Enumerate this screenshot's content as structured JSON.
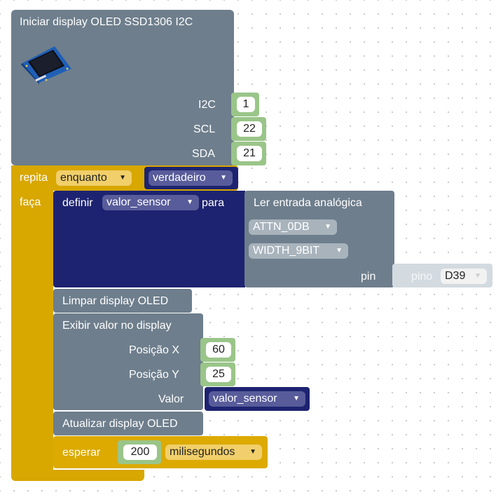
{
  "init_block": {
    "title": "Iniciar display OLED SSD1306 I2C",
    "i2c_label": "I2C",
    "i2c_value": "1",
    "scl_label": "SCL",
    "scl_value": "22",
    "sda_label": "SDA",
    "sda_value": "21"
  },
  "loop_block": {
    "repeat_label": "repita",
    "mode_option": "enquanto",
    "condition_value": "verdadeiro",
    "do_label": "faça"
  },
  "set_block": {
    "label": "definir",
    "variable": "valor_sensor",
    "to_label": "para"
  },
  "analog_block": {
    "title": "Ler entrada analógica",
    "attenuation": "ATTN_0DB",
    "width": "WIDTH_9BIT",
    "pin_label": "pin",
    "pin_block_label": "pino",
    "pin_value": "D39"
  },
  "clear_block": {
    "label": "Limpar display OLED"
  },
  "show_block": {
    "title": "Exibir valor no display",
    "posx_label": "Posição X",
    "posx_value": "60",
    "posy_label": "Posição Y",
    "posy_value": "25",
    "value_label": "Valor",
    "value_variable": "valor_sensor"
  },
  "update_block": {
    "label": "Atualizar display OLED"
  },
  "wait_block": {
    "label": "esperar",
    "amount": "200",
    "unit": "milisegundos"
  },
  "colors": {
    "gray_block": "#6e7e8c",
    "gold_block": "#d8a700",
    "navy_block": "#1d2370",
    "green_block": "#9ac589"
  },
  "icons": {
    "dropdown": "caret-down-icon",
    "device": "oled-module-icon"
  }
}
